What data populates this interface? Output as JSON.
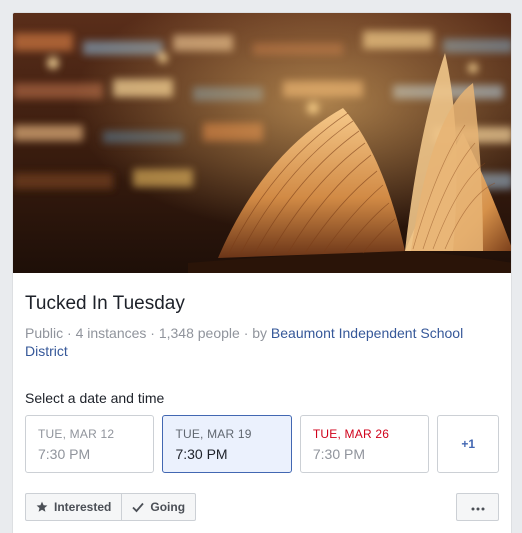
{
  "event": {
    "title": "Tucked In Tuesday",
    "meta_prefix": "Public · 4 instances · 1,348 people · by ",
    "host": "Beaumont Independent School District"
  },
  "schedule": {
    "label": "Select a date and time",
    "dates": [
      {
        "day": "TUE, MAR 12",
        "time": "7:30 PM"
      },
      {
        "day": "TUE, MAR 19",
        "time": "7:30 PM"
      },
      {
        "day": "TUE, MAR 26",
        "time": "7:30 PM"
      }
    ],
    "more": "+1"
  },
  "actions": {
    "interested": "Interested",
    "going": "Going"
  },
  "icons": {
    "interested": "star-icon",
    "going": "checkmark-icon",
    "more": "more-dots-icon"
  },
  "colors": {
    "accent": "#4267b2",
    "link": "#365899",
    "highlight_date": "#d0021b",
    "selected_bg": "#ebf1fd"
  }
}
